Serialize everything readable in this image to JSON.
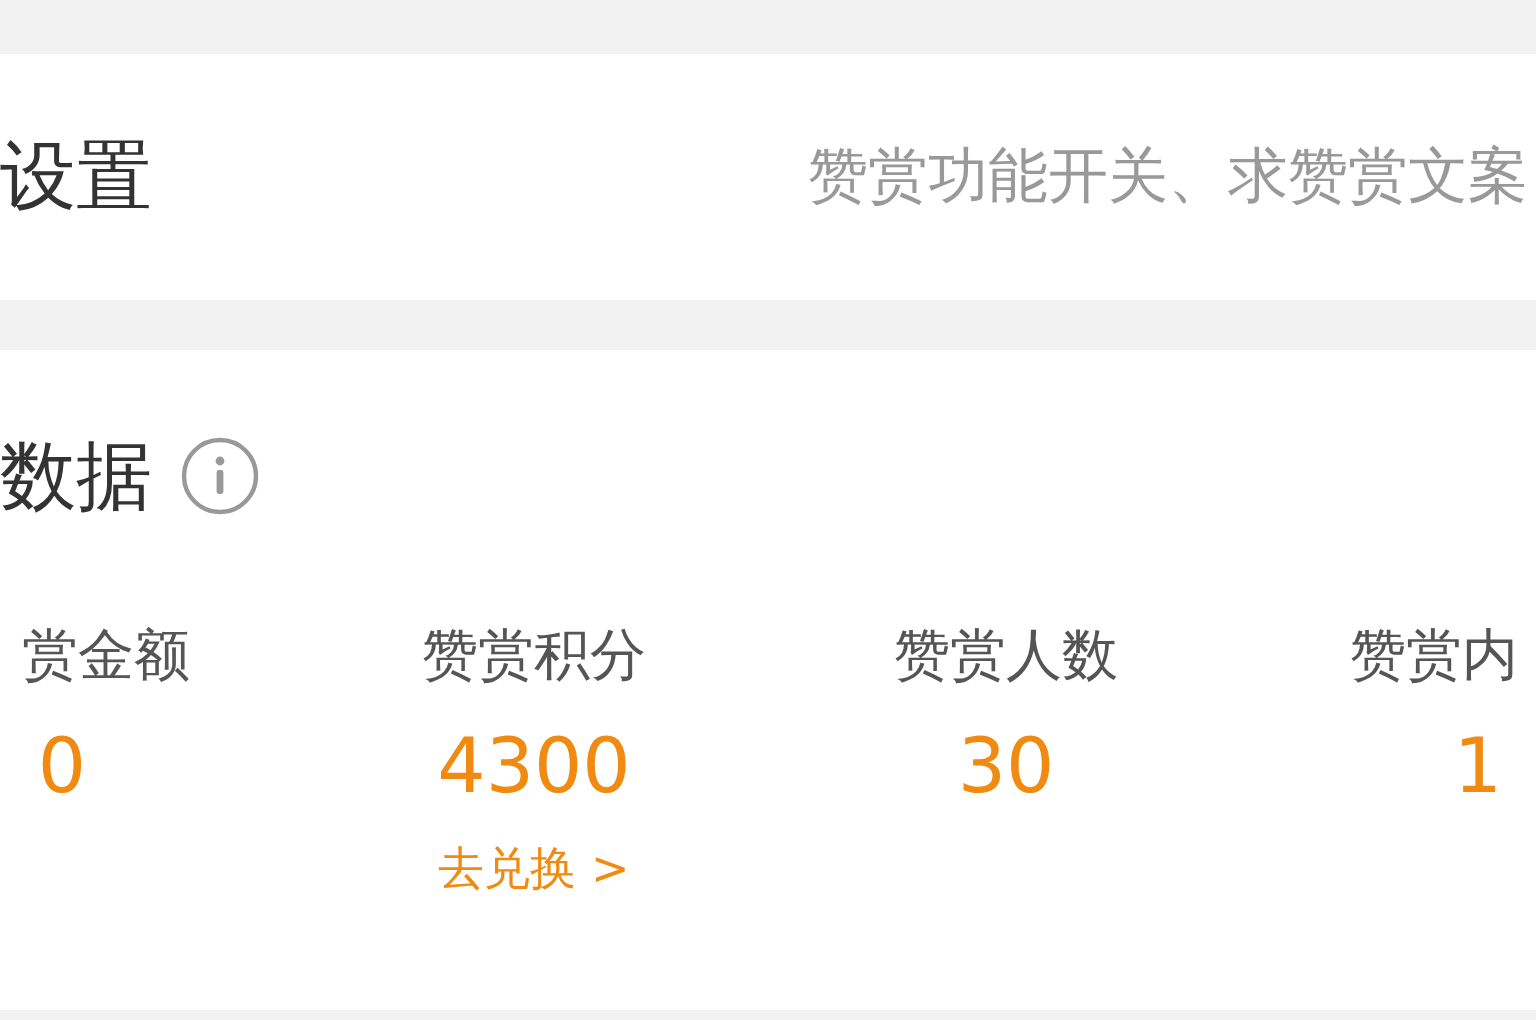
{
  "settings_row": {
    "title": "设置",
    "description": "赞赏功能开关、求赞赏文案"
  },
  "data_section": {
    "title": "数据",
    "stats": [
      {
        "label": "赏金额",
        "value": "0"
      },
      {
        "label": "赞赏积分",
        "value": "4300",
        "link": "去兑换 >"
      },
      {
        "label": "赞赏人数",
        "value": "30"
      },
      {
        "label": "赞赏内",
        "value": "1"
      }
    ]
  }
}
